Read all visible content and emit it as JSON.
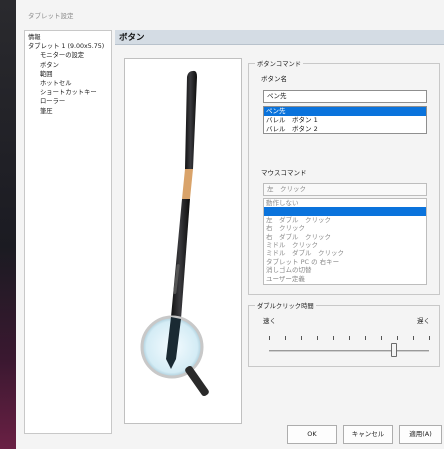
{
  "window": {
    "title": "タブレット設定"
  },
  "tree": {
    "items": [
      {
        "label": "情報",
        "indent": false
      },
      {
        "label": "タブレット 1 (9.00x5.75)",
        "indent": false
      },
      {
        "label": "モニターの設定",
        "indent": true
      },
      {
        "label": "ボタン",
        "indent": true
      },
      {
        "label": "範囲",
        "indent": true
      },
      {
        "label": "ホットセル",
        "indent": true
      },
      {
        "label": "ショートカットキー",
        "indent": true
      },
      {
        "label": "ローラー",
        "indent": true
      },
      {
        "label": "筆圧",
        "indent": true
      }
    ]
  },
  "panel": {
    "title": "ボタン"
  },
  "button_command": {
    "group_title": "ボタンコマンド",
    "name_label": "ボタン名",
    "name_value": "ペン先",
    "list": [
      "ペン先",
      "バレル　ボタン 1",
      "バレル　ボタン 2"
    ],
    "selected_index": 0
  },
  "mouse_command": {
    "group_title": "マウスコマンド",
    "value": "左　クリック",
    "list": [
      "動作しない",
      "",
      "左　ダブル　クリック",
      "右　クリック",
      "右　ダブル　クリック",
      "ミドル　クリック",
      "ミドル　ダブル　クリック",
      "タブレット PC の 右キー",
      "消しゴムの切替",
      "ユーザー定義"
    ],
    "selected_index": 1
  },
  "double_click": {
    "group_title": "ダブルクリック時間",
    "fast_label": "速く",
    "slow_label": "遅く",
    "slider_value": 0.78
  },
  "footer": {
    "ok_label": "OK",
    "cancel_label": "キャンセル",
    "apply_label": "適用(A)"
  }
}
